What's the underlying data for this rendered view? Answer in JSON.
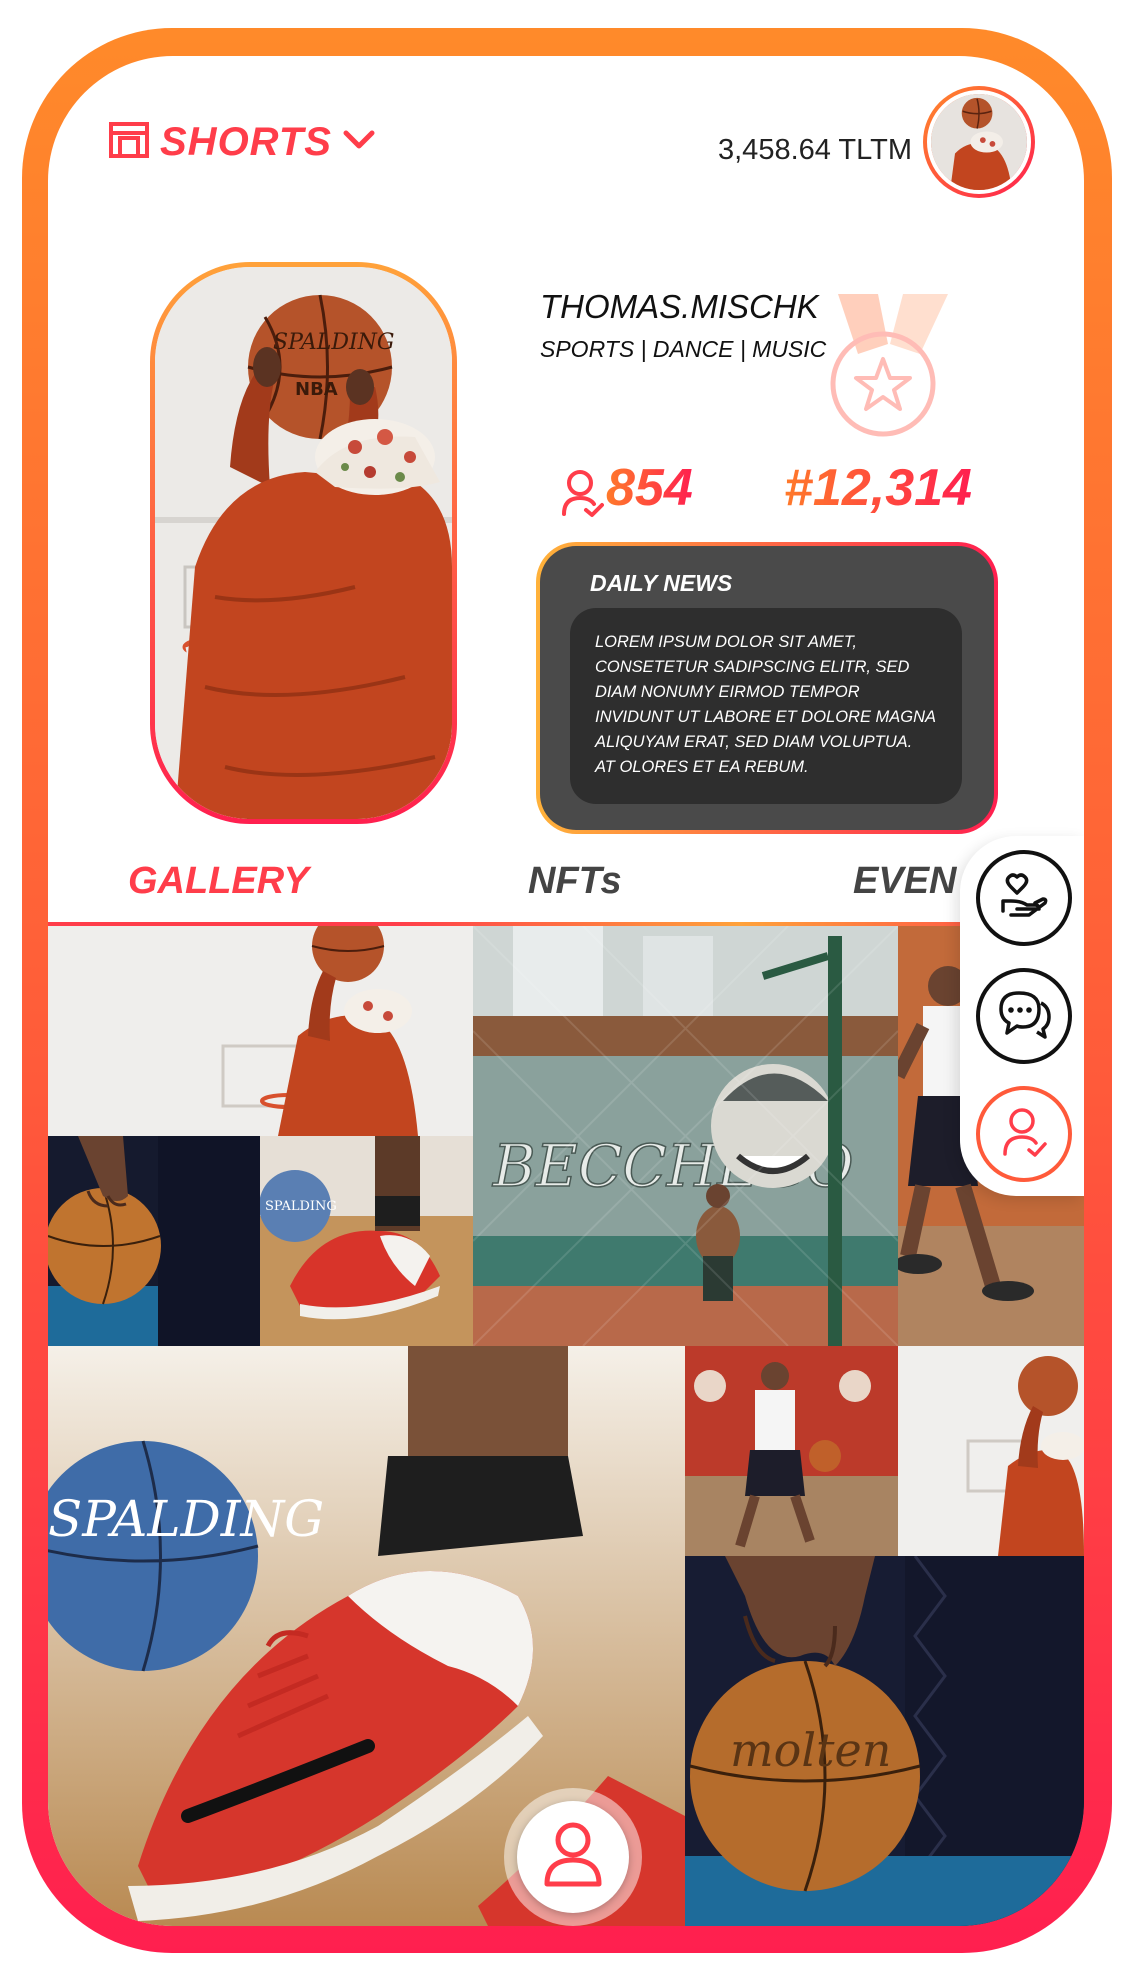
{
  "header": {
    "shorts_label": "SHORTS",
    "balance": "3,458.64 TLTM"
  },
  "profile": {
    "username": "THOMAS.MISCHK",
    "categories": "SPORTS | DANCE | MUSIC"
  },
  "stats": {
    "followers": "854",
    "rank": "#12,314"
  },
  "news": {
    "title": "DAILY NEWS",
    "lines": [
      "LOREM IPSUM DOLOR SIT AMET,",
      "CONSETETUR SADIPSCING ELITR, SED",
      "DIAM NONUMY EIRMOD TEMPOR",
      "INVIDUNT UT LABORE ET DOLORE MAGNA",
      "ALIQUYAM ERAT, SED DIAM VOLUPTUA.",
      "AT OLORES ET EA REBUM."
    ]
  },
  "tabs": [
    {
      "label": "GALLERY",
      "active": true
    },
    {
      "label": "NFTs",
      "active": false
    },
    {
      "label": "EVEN",
      "active": false
    }
  ],
  "icons": {
    "shorts": "shorts-icon",
    "chevron": "chevron-down-icon",
    "followers": "user-check-icon",
    "medal": "medal-icon",
    "donate": "donate-icon",
    "chat": "chat-icon",
    "follow": "user-check-icon",
    "profile": "profile-icon"
  },
  "colors": {
    "accent": "#ff3d4a",
    "gradient_start": "#ff8a2a",
    "gradient_end": "#ff1f4f",
    "news_card": "#4a4a4a"
  }
}
